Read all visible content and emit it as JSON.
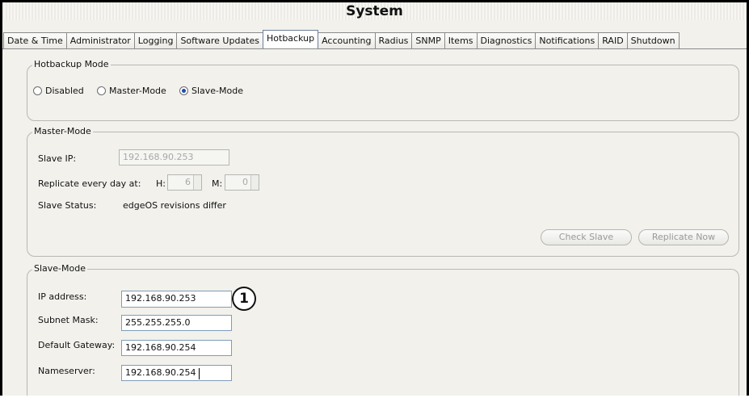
{
  "window": {
    "title": "System"
  },
  "tabs": [
    {
      "label": "Date & Time"
    },
    {
      "label": "Administrator"
    },
    {
      "label": "Logging"
    },
    {
      "label": "Software Updates"
    },
    {
      "label": "Hotbackup"
    },
    {
      "label": "Accounting"
    },
    {
      "label": "Radius"
    },
    {
      "label": "SNMP"
    },
    {
      "label": "Items"
    },
    {
      "label": "Diagnostics"
    },
    {
      "label": "Notifications"
    },
    {
      "label": "RAID"
    },
    {
      "label": "Shutdown"
    }
  ],
  "active_tab": "Hotbackup",
  "hotbackup_mode": {
    "legend": "Hotbackup Mode",
    "options": [
      {
        "label": "Disabled",
        "selected": false
      },
      {
        "label": "Master-Mode",
        "selected": false
      },
      {
        "label": "Slave-Mode",
        "selected": true
      }
    ]
  },
  "master_mode": {
    "legend": "Master-Mode",
    "slave_ip_label": "Slave IP:",
    "slave_ip_value": "192.168.90.253",
    "replicate_label": "Replicate every day at:",
    "hour_label": "H:",
    "hour_value": "6",
    "minute_label": "M:",
    "minute_value": "0",
    "slave_status_label": "Slave Status:",
    "slave_status_value": "edgeOS revisions differ",
    "check_slave_label": "Check Slave",
    "replicate_now_label": "Replicate Now"
  },
  "slave_mode": {
    "legend": "Slave-Mode",
    "ip_label": "IP address:",
    "ip_value": "192.168.90.253",
    "subnet_label": "Subnet Mask:",
    "subnet_value": "255.255.255.0",
    "gateway_label": "Default Gateway:",
    "gateway_value": "192.168.90.254",
    "nameserver_label": "Nameserver:",
    "nameserver_value": "192.168.90.254"
  },
  "callout": {
    "number": "1"
  },
  "colors": {
    "selected_radio": "#2249b0",
    "field_border": "#7f9db9",
    "panel_bg": "#f2f1ec"
  }
}
